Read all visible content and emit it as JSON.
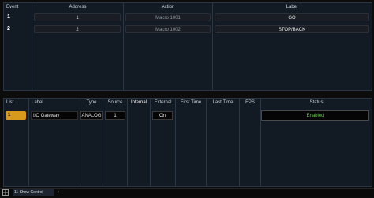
{
  "events": {
    "headers": {
      "event": "Event",
      "address": "Address",
      "action": "Action",
      "label": "Label"
    },
    "rows": [
      {
        "event": "1",
        "address": "1",
        "action": "Macro  1001",
        "label": "GO"
      },
      {
        "event": "2",
        "address": "2",
        "action": "Macro  1002",
        "label": "STOP/BACK"
      }
    ]
  },
  "list": {
    "headers": {
      "list": "List",
      "label": "Label",
      "type": "Type",
      "source": "Source",
      "internal": "Internal",
      "external": "External",
      "first_time": "First Time",
      "last_time": "Last Time",
      "fps": "FPS",
      "status": "Status"
    },
    "row": {
      "list": "1",
      "label": "I/O Gateway",
      "type": "ANALOG",
      "source": "1",
      "external": "On",
      "status": "Enabled"
    }
  },
  "tabs": {
    "show_control": "11 Show Control",
    "add": "+"
  },
  "colors": {
    "accent": "#d89a1c",
    "status_enabled": "#58d23a"
  }
}
